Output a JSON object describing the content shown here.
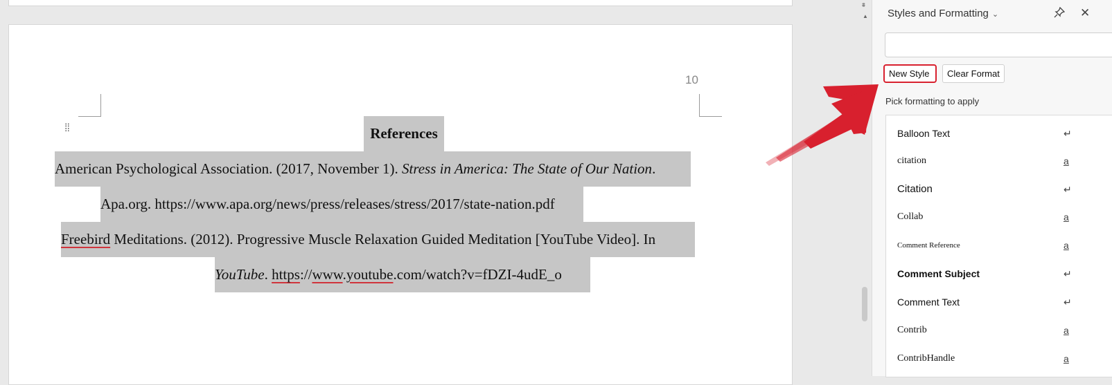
{
  "document": {
    "page_number": "10",
    "heading": "References",
    "ref1_line1_plain": "American Psychological Association. (2017, November 1). ",
    "ref1_line1_italic": "Stress in America: The State of Our Nation",
    "ref1_line1_end": ".",
    "ref1_line2": "Apa.org. https://www.apa.org/news/press/releases/stress/2017/state-nation.pdf",
    "ref2_line1_word": "Freebird",
    "ref2_line1_rest": " Meditations. (2012). Progressive Muscle Relaxation Guided Meditation [YouTube Video]. In",
    "ref2_line2_italic": "YouTube",
    "ref2_line2_dot": ". ",
    "ref2_url_a": "https",
    "ref2_url_b": "://",
    "ref2_url_c": "www",
    "ref2_url_d": ".",
    "ref2_url_e": "youtube",
    "ref2_url_f": ".com/watch?v=fDZI-4udE_o"
  },
  "panel": {
    "title": "Styles and Formatting",
    "new_style_label": "New Style",
    "clear_format_label": "Clear Format",
    "pick_label": "Pick formatting to apply",
    "styles": [
      {
        "name": "Balloon Text",
        "marker": "↵"
      },
      {
        "name": "citation",
        "marker": "a"
      },
      {
        "name": "Citation",
        "marker": "↵"
      },
      {
        "name": "Collab",
        "marker": "a"
      },
      {
        "name": "Comment Reference",
        "marker": "a"
      },
      {
        "name": "Comment Subject",
        "marker": "↵"
      },
      {
        "name": "Comment Text",
        "marker": "↵"
      },
      {
        "name": "Contrib",
        "marker": "a"
      },
      {
        "name": "ContribHandle",
        "marker": "a"
      }
    ]
  },
  "annotation_color": "#d8202e"
}
